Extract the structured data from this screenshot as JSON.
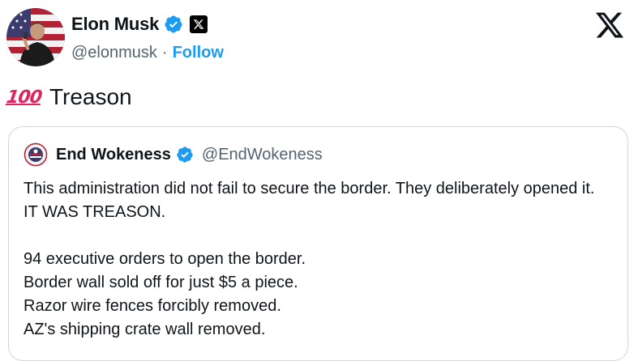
{
  "author": {
    "display_name": "Elon Musk",
    "handle": "@elonmusk",
    "separator": "·",
    "follow_label": "Follow",
    "avatar_icon": "profile-photo",
    "verified_icon": "verified-badge-icon",
    "affiliate_icon": "x-affiliate-badge-icon"
  },
  "platform_logo": "x-logo-icon",
  "tweet": {
    "emoji": "💯",
    "emoji_text": "100",
    "text": "Treason"
  },
  "quoted_tweet": {
    "display_name": "End Wokeness",
    "handle": "@EndWokeness",
    "paragraph1": "This administration did not fail to secure the border. They deliberately opened it. IT WAS TREASON.",
    "lines": [
      "94 executive orders to open the border.",
      "Border wall sold off for just $5 a piece.",
      "Razor wire fences forcibly removed.",
      "AZ's shipping crate wall removed."
    ]
  },
  "colors": {
    "accent": "#1d9bf0",
    "verified": "#1d9bf0",
    "secondary_text": "#536471",
    "primary_text": "#0f1419",
    "border": "#cfd9de",
    "emoji_red": "#e0245e"
  }
}
